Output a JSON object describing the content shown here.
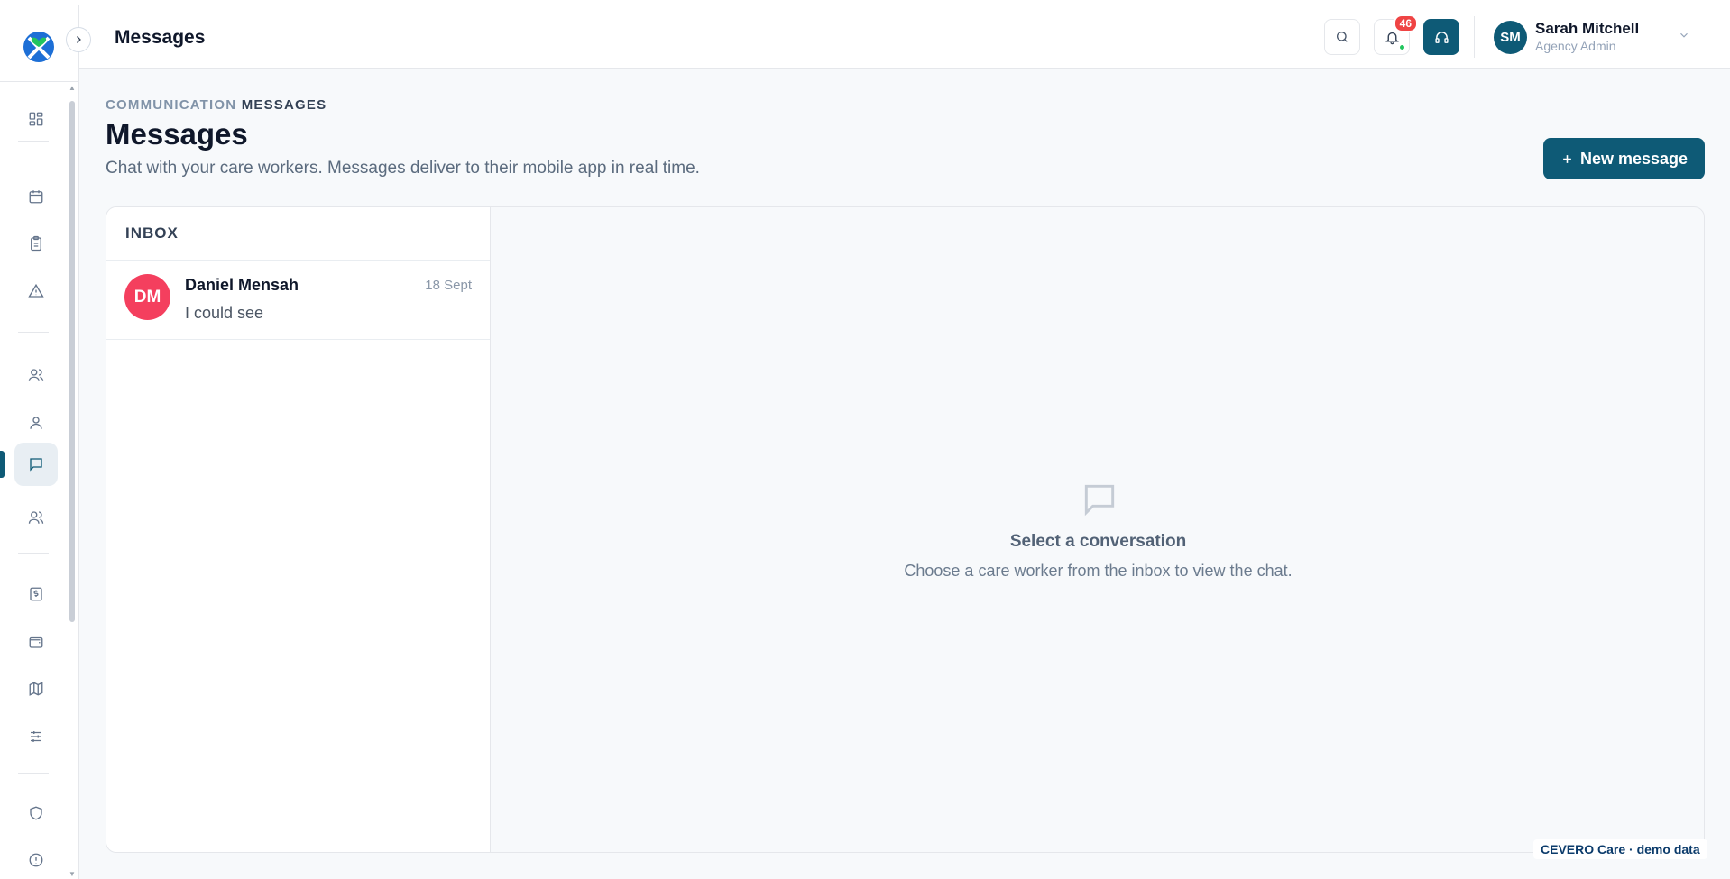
{
  "header": {
    "title": "Messages",
    "notifications_count": "46",
    "user": {
      "initials": "SM",
      "name": "Sarah Mitchell",
      "role": "Agency Admin"
    }
  },
  "sidebar": {
    "items": [
      {
        "name": "dashboard",
        "icon": "grid-icon"
      },
      {
        "name": "calendar",
        "icon": "calendar-icon"
      },
      {
        "name": "clipboard",
        "icon": "clipboard-icon"
      },
      {
        "name": "alerts",
        "icon": "alert-triangle-icon"
      },
      {
        "name": "team",
        "icon": "users-icon"
      },
      {
        "name": "profile",
        "icon": "user-icon"
      },
      {
        "name": "messages",
        "icon": "message-square-icon",
        "active": true
      },
      {
        "name": "care-workers",
        "icon": "users-icon"
      },
      {
        "name": "billing",
        "icon": "dollar-receipt-icon"
      },
      {
        "name": "wallet",
        "icon": "wallet-icon"
      },
      {
        "name": "map",
        "icon": "map-icon"
      },
      {
        "name": "settings",
        "icon": "sliders-icon"
      },
      {
        "name": "security",
        "icon": "shield-icon"
      },
      {
        "name": "info",
        "icon": "info-icon"
      }
    ]
  },
  "page": {
    "breadcrumb_section": "COMMUNICATION",
    "breadcrumb_current": "MESSAGES",
    "title": "Messages",
    "subtitle": "Chat with your care workers. Messages deliver to their mobile app in real time.",
    "new_button": "New message"
  },
  "inbox": {
    "heading": "INBOX",
    "conversations": [
      {
        "initials": "DM",
        "name": "Daniel Mensah",
        "date": "18 Sept",
        "preview": "I could see"
      }
    ]
  },
  "empty_state": {
    "title": "Select a conversation",
    "subtitle": "Choose a care worker from the inbox to view the chat."
  },
  "footer": {
    "watermark": "CEVERO Care · demo data"
  },
  "colors": {
    "primary": "#0e5a76",
    "badge": "#ef4444",
    "avatar_dm": "#f43f5e",
    "online": "#22c55e"
  }
}
